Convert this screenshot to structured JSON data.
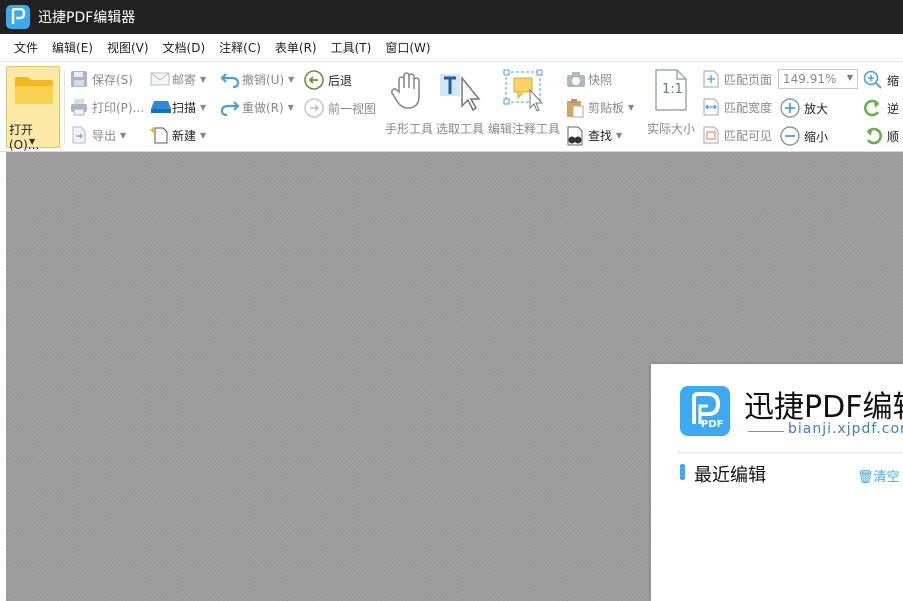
{
  "window": {
    "title": "迅捷PDF编辑器"
  },
  "menu": [
    "文件",
    "编辑(E)",
    "视图(V)",
    "文档(D)",
    "注释(C)",
    "表单(R)",
    "工具(T)",
    "窗口(W)"
  ],
  "ribbon": {
    "open": "打开(O)...",
    "save": "保存(S)",
    "print": "打印(P)...",
    "export": "导出",
    "mail": "邮寄",
    "scan": "扫描",
    "new": "新建",
    "undo": "撤销(U)",
    "redo": "重做(R)",
    "back": "后退",
    "prev_view": "前一视图",
    "hand_tool": "手形工具",
    "select_tool": "选取工具",
    "annot_tool": "编辑注释工具",
    "snapshot": "快照",
    "clipboard": "剪贴板",
    "find": "查找",
    "actual_size": "实际大小",
    "actual_size_icon_text": "1:1",
    "fit_page": "匹配页面",
    "fit_width": "匹配宽度",
    "fit_visible": "匹配可见",
    "zoom_value": "149.91%",
    "zoom_in": "放大",
    "zoom_out": "缩小",
    "shrink_partial": "缩",
    "rotate_ccw_partial": "逆",
    "rotate_cw_partial": "顺"
  },
  "start_panel": {
    "brand": "迅捷PDF编辑",
    "url": "bianji.xjpdf.com",
    "logo_text": "PDF",
    "recent_title": "最近编辑",
    "clear": "清空"
  },
  "colors": {
    "accent": "#3da9f5",
    "titlebar": "#212121",
    "open_button": "#fde9a6",
    "workspace": "#9e9e9e"
  }
}
